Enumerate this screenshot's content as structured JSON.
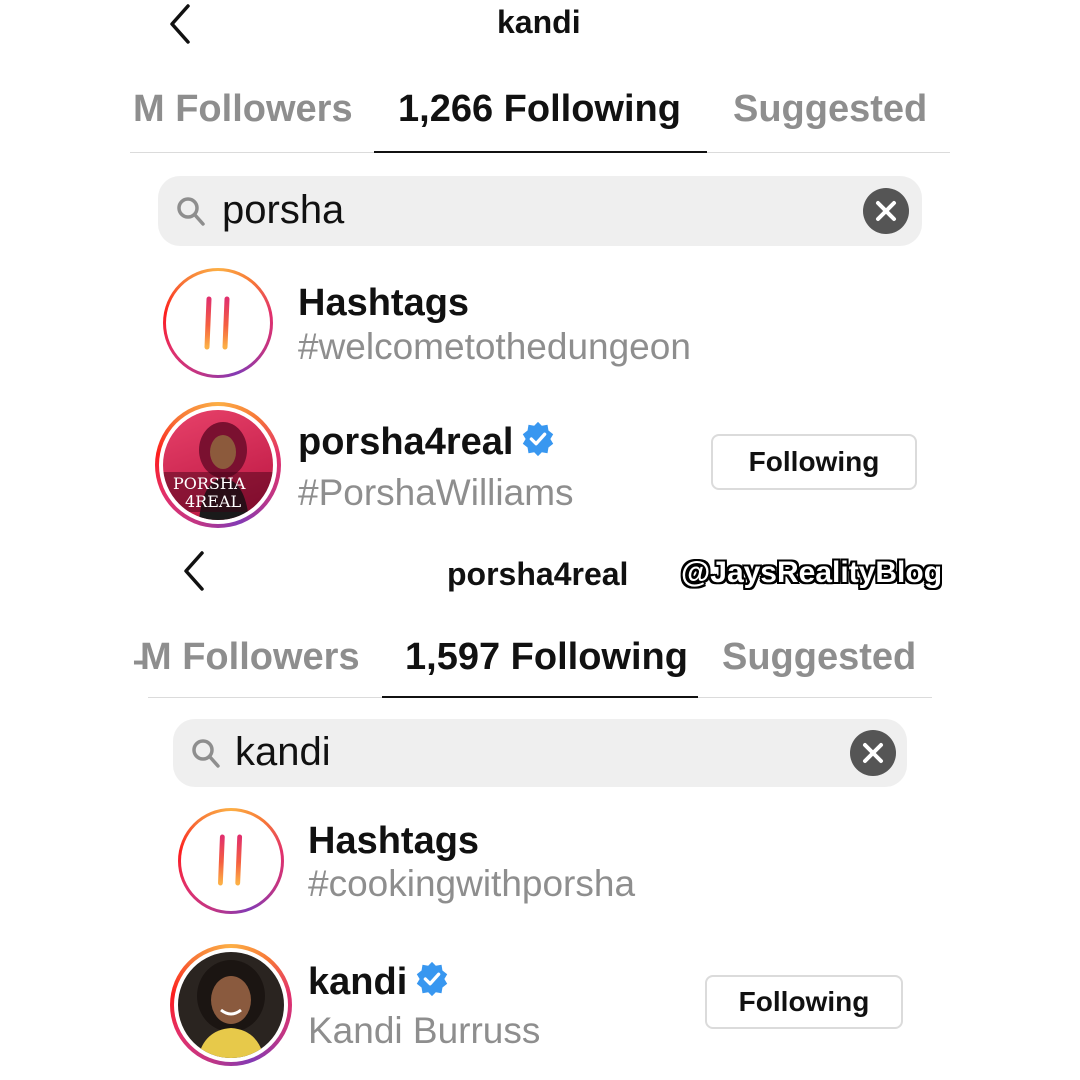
{
  "panels": [
    {
      "header_title": "kandi",
      "tabs": [
        {
          "label": "M Followers"
        },
        {
          "label": "1,266 Following"
        },
        {
          "label": "Suggested"
        }
      ],
      "search_value": "porsha",
      "hashtag_row": {
        "title": "Hashtags",
        "subtitle": "#welcometothedungeon"
      },
      "user_row": {
        "username": "porsha4real",
        "subtitle": "#PorshaWilliams",
        "button_label": "Following",
        "avatar_text_line1": "PORSHA",
        "avatar_text_line2": "4REAL"
      }
    },
    {
      "header_title": "porsha4real",
      "tabs": [
        {
          "label": "̵M Followers"
        },
        {
          "label": "1,597 Following"
        },
        {
          "label": "Suggested"
        }
      ],
      "search_value": "kandi",
      "hashtag_row": {
        "title": "Hashtags",
        "subtitle": "#cookingwithporsha"
      },
      "user_row": {
        "username": "kandi",
        "subtitle": "Kandi Burruss",
        "button_label": "Following"
      }
    }
  ],
  "watermark": "@JaysRealityBlog",
  "colors": {
    "verified": "#3897f0",
    "inactive_text": "#8e8e8e",
    "search_bg": "#efefef"
  }
}
